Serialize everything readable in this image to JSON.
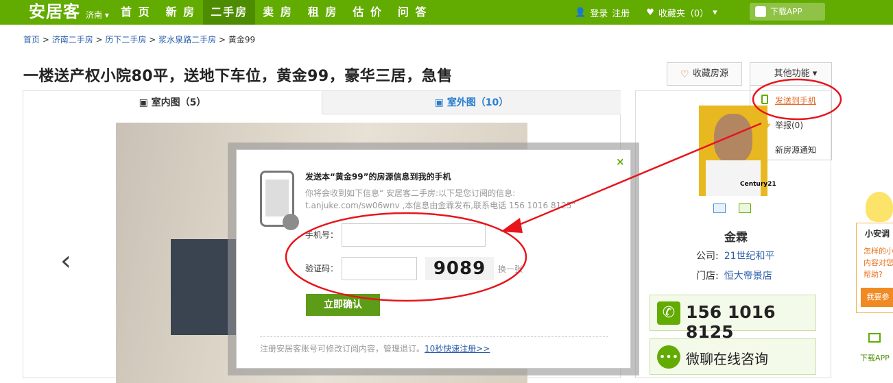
{
  "header": {
    "logo": "安居客",
    "city": "济南 ▾",
    "nav": [
      "首 页",
      "新 房",
      "二手房",
      "卖 房",
      "租 房",
      "估 价",
      "问 答"
    ],
    "login": "登录",
    "register": "注册",
    "favorites": "收藏夹（0）",
    "download_app": "下载APP"
  },
  "breadcrumb": {
    "items": [
      "首页",
      "济南二手房",
      "历下二手房",
      "浆水泉路二手房"
    ],
    "current": "黄金99"
  },
  "listing": {
    "title": "一楼送产权小院80平，送地下车位，黄金99，豪华三居，急售",
    "fav_button": "收藏房源",
    "more_button": "其他功能 ▾",
    "dropdown": [
      "发送到手机",
      "举报(0)",
      "新房源通知"
    ]
  },
  "gallery": {
    "tab_indoor": "室内图（5）",
    "tab_outdoor": "室外图（10）",
    "prev": "‹"
  },
  "agent": {
    "name": "金霖",
    "company_label": "公司:",
    "company": "21世纪和平",
    "store_label": "门店:",
    "store": "恒大帝景店",
    "phone": "156 1016 8125",
    "chat": "微聊在线咨询",
    "logo_text": "Century21"
  },
  "xiaoan": {
    "title": "小安调",
    "text": "怎样的小 内容对您 帮助?",
    "button": "我要参",
    "download": "下载APP"
  },
  "modal": {
    "title": "发送本“黄金99”的房源信息到我的手机",
    "desc": "你将会收到如下信息“ 安居客二手房:以下是您订阅的信息: t.anjuke.com/sw06wnv ,本信息由金霖发布,联系电话 156 1016 8125”",
    "phone_label": "手机号：",
    "code_label": "验证码：",
    "captcha": "9089",
    "change": "换一张",
    "confirm": "立即确认",
    "footer": "注册安居客账号可修改订阅内容，管理退订。",
    "footer_link": "10秒快速注册>>",
    "close": "×"
  },
  "colors": {
    "brand": "#62ab00",
    "annotation": "#e8141c"
  }
}
